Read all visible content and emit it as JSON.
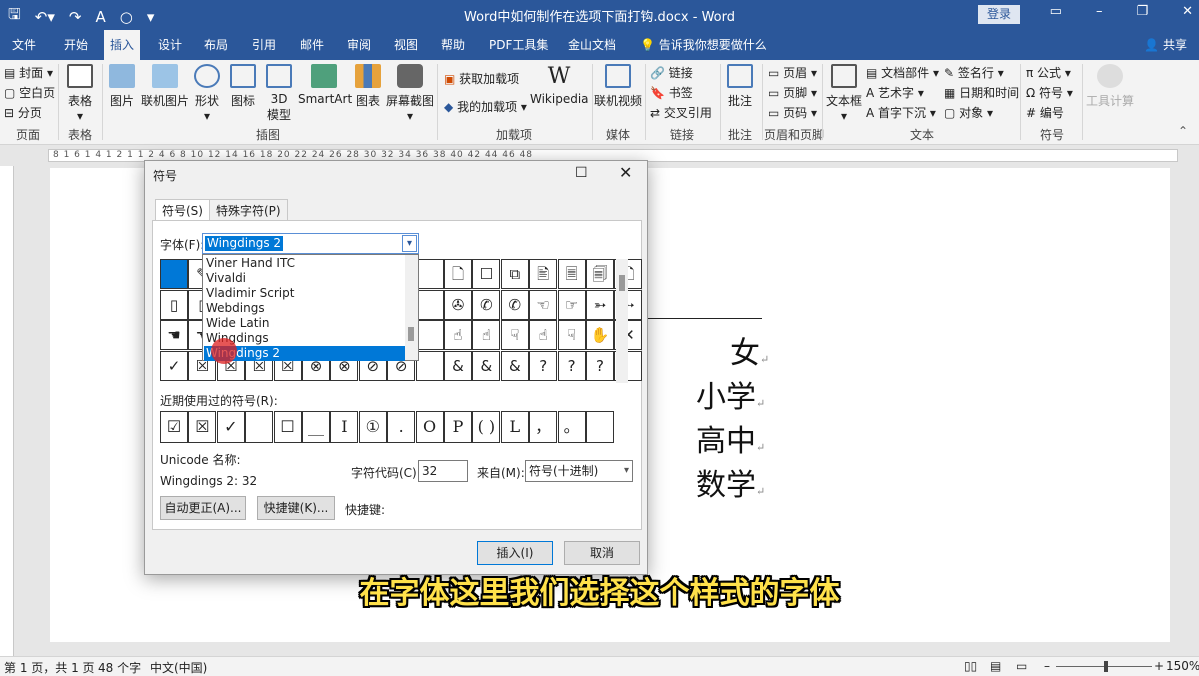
{
  "window": {
    "title": "Word中如何制作在选项下面打钩.docx - Word",
    "login": "登录",
    "qat_icons": [
      "save-icon",
      "undo-icon",
      "redo-icon",
      "font-icon",
      "touch-mode-icon",
      "customize-icon"
    ]
  },
  "tabs": [
    "文件",
    "开始",
    "插入",
    "设计",
    "布局",
    "引用",
    "邮件",
    "审阅",
    "视图",
    "帮助",
    "PDF工具集",
    "金山文档",
    "告诉我你想要做什么"
  ],
  "active_tab": "插入",
  "share": "共享",
  "ribbon": {
    "pages": [
      "封面",
      "空白页",
      "分页"
    ],
    "pages_group": "页面",
    "table": "表格",
    "table_group": "表格",
    "illus": [
      "图片",
      "联机图片",
      "形状",
      "图标",
      "3D",
      "SmartArt",
      "图表",
      "屏幕截图"
    ],
    "illus_3d_sub": "模型",
    "illus_group": "插图",
    "addins": [
      "获取加载项",
      "我的加载项"
    ],
    "wikipedia": "Wikipedia",
    "addins_group": "加载项",
    "media": "联机视频",
    "media_group": "媒体",
    "links": [
      "链接",
      "书签",
      "交叉引用"
    ],
    "links_group": "链接",
    "comment": "批注",
    "comment_group": "批注",
    "hf": [
      "页眉",
      "页脚",
      "页码"
    ],
    "hf_group": "页眉和页脚",
    "textbox": "文本框",
    "text_items": [
      "文档部件",
      "艺术字",
      "首字下沉",
      "签名行",
      "日期和时间",
      "对象"
    ],
    "text_group": "文本",
    "symbols": [
      "公式",
      "符号",
      "编号"
    ],
    "symbols_group": "符号",
    "tools": "工具计算"
  },
  "ruler_text": "8 1 6 1 4 1 2 1 1 2 4 6 8 10 12 14 16 18 20 22 24 26 28 30 32 34 36 38 40 42 44 46 48",
  "document": {
    "lines": [
      "女",
      "小学",
      "高中",
      "数学"
    ]
  },
  "status": {
    "page": "第 1 页，共 1 页",
    "words": "48 个字",
    "lang": "中文(中国)",
    "zoom": "150%"
  },
  "dialog": {
    "title": "符号",
    "tabs": [
      "符号(S)",
      "特殊字符(P)"
    ],
    "font_label": "字体(F):",
    "font_value": "Wingdings 2",
    "font_options": [
      "Viner Hand ITC",
      "Vivaldi",
      "Vladimir Script",
      "Webdings",
      "Wide Latin",
      "Wingdings",
      "Wingdings 2"
    ],
    "selected_font": "Wingdings 2",
    "grid_rows": [
      [
        "",
        "✎",
        "",
        "",
        "",
        "",
        "",
        "",
        "",
        "",
        "🗋",
        "☐",
        "⧉",
        "🖹",
        "🗏",
        "🗐",
        "🗋"
      ],
      [
        "▯",
        "▯",
        "",
        "",
        "",
        "",
        "",
        "",
        "",
        "",
        "✇",
        "✆",
        "✆",
        "☜",
        "☞",
        "➳",
        "➳"
      ],
      [
        "☚",
        "☚",
        "",
        "",
        "",
        "",
        "",
        "",
        "",
        "",
        "☝",
        "☝",
        "☟",
        "☝",
        "☟",
        "✋",
        "✕"
      ],
      [
        "✓",
        "☒",
        "☒",
        "☒",
        "☒",
        "⊗",
        "⊗",
        "⊘",
        "⊘",
        "",
        "&",
        "&",
        "&",
        "?",
        "?",
        "?",
        ""
      ]
    ],
    "recent_label": "近期使用过的符号(R):",
    "recent": [
      "☑",
      "☒",
      "✓",
      "",
      "☐",
      "__",
      "I",
      "①",
      ".",
      "O",
      "P",
      "( )",
      "L",
      "，",
      "。",
      ""
    ],
    "unicode_label": "Unicode 名称:",
    "unicode_name": "Wingdings 2: 32",
    "code_label": "字符代码(C):",
    "code_value": "32",
    "from_label": "来自(M):",
    "from_value": "符号(十进制)",
    "autocorrect": "自动更正(A)...",
    "shortcut": "快捷键(K)...",
    "shortcut_label": "快捷键:",
    "insert": "插入(I)",
    "cancel": "取消"
  },
  "subtitle": "在字体这里我们选择这个样式的字体",
  "colors": {
    "brand": "#2b579a",
    "select": "#0078d7",
    "subtitle": "#ffe14a"
  }
}
